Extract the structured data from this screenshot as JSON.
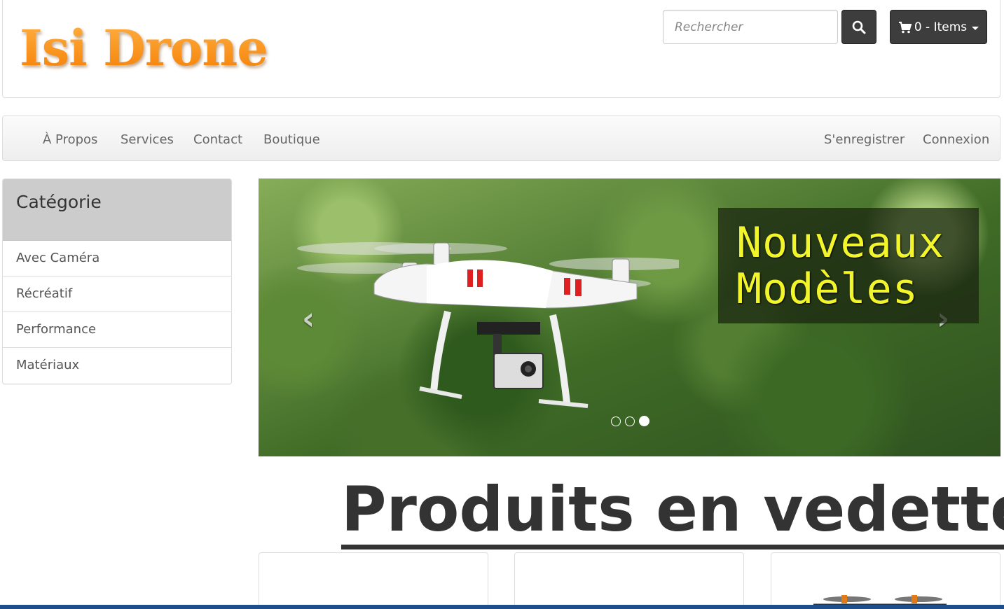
{
  "header": {
    "logo_text": "Isi Drone",
    "search": {
      "placeholder": "Rechercher"
    },
    "cart": {
      "label": "0 - Items"
    }
  },
  "navbar": {
    "left_items": [
      "À Propos",
      "Services",
      "Contact",
      "Boutique"
    ],
    "right_items": [
      "S'enregistrer",
      "Connexion"
    ]
  },
  "sidebar": {
    "title": "Catégorie",
    "items": [
      "Avec Caméra",
      "Récréatif",
      "Performance",
      "Matériaux"
    ]
  },
  "carousel": {
    "promo_line1": "Nouveaux",
    "promo_line2": "Modèles",
    "slide_count": 3,
    "active_slide": 3
  },
  "featured": {
    "title": "Produits en vedette"
  }
}
